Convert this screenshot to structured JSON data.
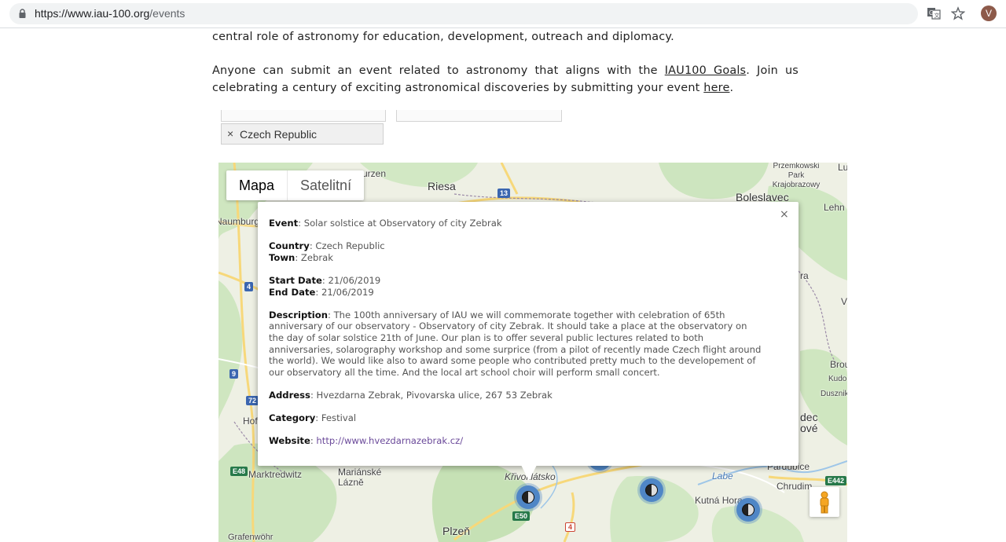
{
  "browser": {
    "url_host": "https://www.iau-100.org",
    "url_path": "/events",
    "avatar_letter": "V"
  },
  "intro": {
    "line_top": "central role of astronomy for education, development, outreach and diplomacy.",
    "p2_before": "Anyone can submit an event related to astronomy that aligns with the ",
    "p2_link1": "IAU100 Goals",
    "p2_middle": ".  Join us celebrating a century of exciting astronomical discoveries by submitting your event ",
    "p2_link2": "here",
    "p2_after": "."
  },
  "filters": {
    "country_tag": "Czech Republic",
    "remove_symbol": "×"
  },
  "map": {
    "type_controls": [
      "Mapa",
      "Satelitní"
    ],
    "places": [
      "Riesa",
      "Boleslavec",
      "Przemkowski Park Krajobrazowy",
      "Lehn",
      "Naumburg",
      "Marktredwitz",
      "Mariánské Lázně",
      "Křivoklátsko",
      "Plzeň",
      "Pardubice",
      "Chrudim",
      "Kutná Hora",
      "Grafenwöhr",
      "Labe",
      "urzen",
      "Lu",
      "ra",
      "V",
      "Brou",
      "Kudo",
      "Dusznik",
      "dec",
      "ové",
      "Hof"
    ],
    "road_shields": [
      "13",
      "4",
      "9",
      "72",
      "E48",
      "E50",
      "E442",
      "4"
    ]
  },
  "info": {
    "close_symbol": "×",
    "event_label": "Event",
    "event": "Solar solstice at Observatory of city Zebrak",
    "country_label": "Country",
    "country": "Czech Republic",
    "town_label": "Town",
    "town": "Zebrak",
    "start_label": "Start Date",
    "start": "21/06/2019",
    "end_label": "End Date",
    "end": "21/06/2019",
    "description_label": "Description",
    "description": "The 100th anniversary of IAU we will commemorate together with celebration of 65th anniversary of our observatory - Observatory of city Zebrak. It should take a place at the observatory on the day of solar solstice 21th of June. Our plan is to offer several public lectures related to both anniversaries, solarography workshop and some surprice (from a pilot of recently made Czech flight around the world). We would like also to award some people who contributed pretty much to the developement of our observatory all the time. And the local art school choir will perform small concert.",
    "address_label": "Address",
    "address": "Hvezdarna Zebrak, Pivovarska ulice, 267 53 Zebrak",
    "category_label": "Category",
    "category": "Festival",
    "website_label": "Website",
    "website": "http://www.hvezdarnazebrak.cz/"
  }
}
